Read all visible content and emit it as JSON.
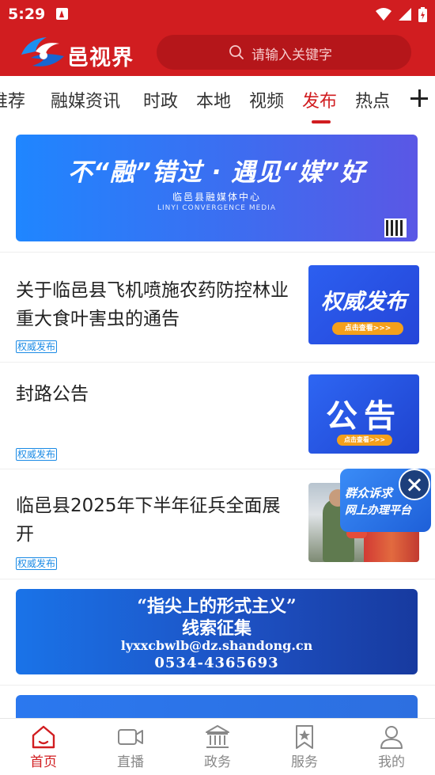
{
  "status_bar": {
    "time": "5:29"
  },
  "header": {
    "app_name": "邑视界",
    "search_placeholder": "请输入关键字"
  },
  "tabs": {
    "items": [
      {
        "label": "推荐",
        "active": false
      },
      {
        "label": "融媒资讯",
        "active": false
      },
      {
        "label": "时政",
        "active": false
      },
      {
        "label": "本地",
        "active": false
      },
      {
        "label": "视频",
        "active": false
      },
      {
        "label": "发布",
        "active": true
      },
      {
        "label": "热点",
        "active": false
      }
    ],
    "add_icon": "plus-icon"
  },
  "banner_top": {
    "headline": "不“融”错过 · 遇见“媒”好",
    "org": "临邑县融媒体中心",
    "org_en": "LINYI CONVERGENCE MEDIA"
  },
  "news": [
    {
      "title": "关于临邑县飞机喷施农药防控林业  重大食叶害虫的通告",
      "tag": "权威发布",
      "thumb_text": "权威发布",
      "thumb_button": "点击查看>>>"
    },
    {
      "title": "封路公告",
      "tag": "权威发布",
      "thumb_text": "公告",
      "thumb_button": "点击查看>>>"
    },
    {
      "title": "临邑县2025年下半年征兵全面展开",
      "tag": "权威发布"
    }
  ],
  "banner_mid": {
    "line1": "“指尖上的形式主义”",
    "line2": "线索征集",
    "line3": "lyxxcbwlb@dz.shandong.cn",
    "line4": "0534-4365693"
  },
  "float_widget": {
    "line1": "群众诉求",
    "line2": "网上办理平台"
  },
  "bottom_nav": [
    {
      "label": "首页",
      "icon": "home-icon",
      "active": true
    },
    {
      "label": "直播",
      "icon": "video-camera-icon",
      "active": false
    },
    {
      "label": "政务",
      "icon": "government-building-icon",
      "active": false
    },
    {
      "label": "服务",
      "icon": "bookmark-star-icon",
      "active": false
    },
    {
      "label": "我的",
      "icon": "user-icon",
      "active": false
    }
  ],
  "colors": {
    "brand_red": "#d11d20",
    "tag_blue": "#1a8ae5",
    "banner_blue": "#2b78ef"
  }
}
